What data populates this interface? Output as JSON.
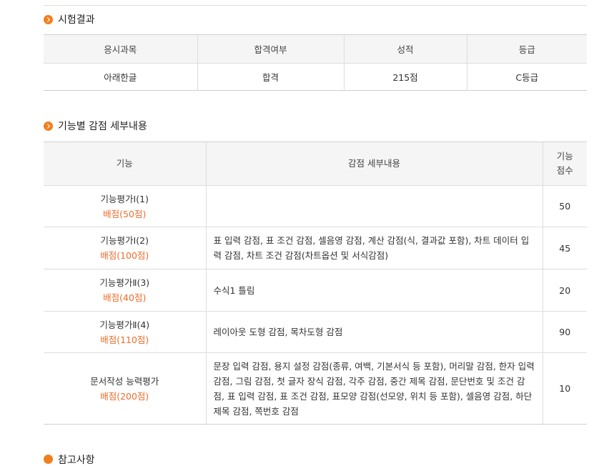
{
  "results": {
    "title": "시험결과",
    "headers": [
      "응시과목",
      "합격여부",
      "성적",
      "등급"
    ],
    "row": [
      "아래한글",
      "합격",
      "215점",
      "C등급"
    ]
  },
  "deductions": {
    "title": "기능별 감점 세부내용",
    "headers": {
      "function": "기능",
      "detail": "감점 세부내용",
      "score_line1": "기능",
      "score_line2": "점수"
    },
    "rows": [
      {
        "name": "기능평가Ⅰ(1)",
        "allocation": "배점(50점)",
        "detail": "",
        "score": "50"
      },
      {
        "name": "기능평가Ⅰ(2)",
        "allocation": "배점(100점)",
        "detail": "표 입력 감점, 표 조건 감점, 셀음영 감점, 계산 감점(식, 결과값 포함), 차트 데이터 입력 감점, 차트 조건 감점(차트옵션 및 서식감점)",
        "score": "45"
      },
      {
        "name": "기능평가Ⅱ(3)",
        "allocation": "배점(40점)",
        "detail": "수식1 틀림",
        "score": "20"
      },
      {
        "name": "기능평가Ⅱ(4)",
        "allocation": "배점(110점)",
        "detail": "레이아웃 도형 감점, 목차도형 감점",
        "score": "90"
      },
      {
        "name": "문서작성 능력평가",
        "allocation": "배점(200점)",
        "detail": "문장 입력 감점, 용지 설정 감점(종류, 여백, 기본서식 등 포함), 머리말 감점, 한자 입력 감점, 그림 감점, 첫 글자 장식 감점, 각주 감점, 중간 제목 감점, 문단번호 및 조건 감점, 표 입력 감점, 표 조건 감점, 표모양 감점(선모양, 위치 등 포함), 셀음영 감점, 하단 제목 감점, 쪽번호 감점",
        "score": "10"
      }
    ]
  },
  "next_section": {
    "title": "참고사항"
  },
  "colors": {
    "accent": "#f07f1f",
    "allocation_text": "#ef6c2a",
    "header_bg": "#f5f5f5"
  }
}
